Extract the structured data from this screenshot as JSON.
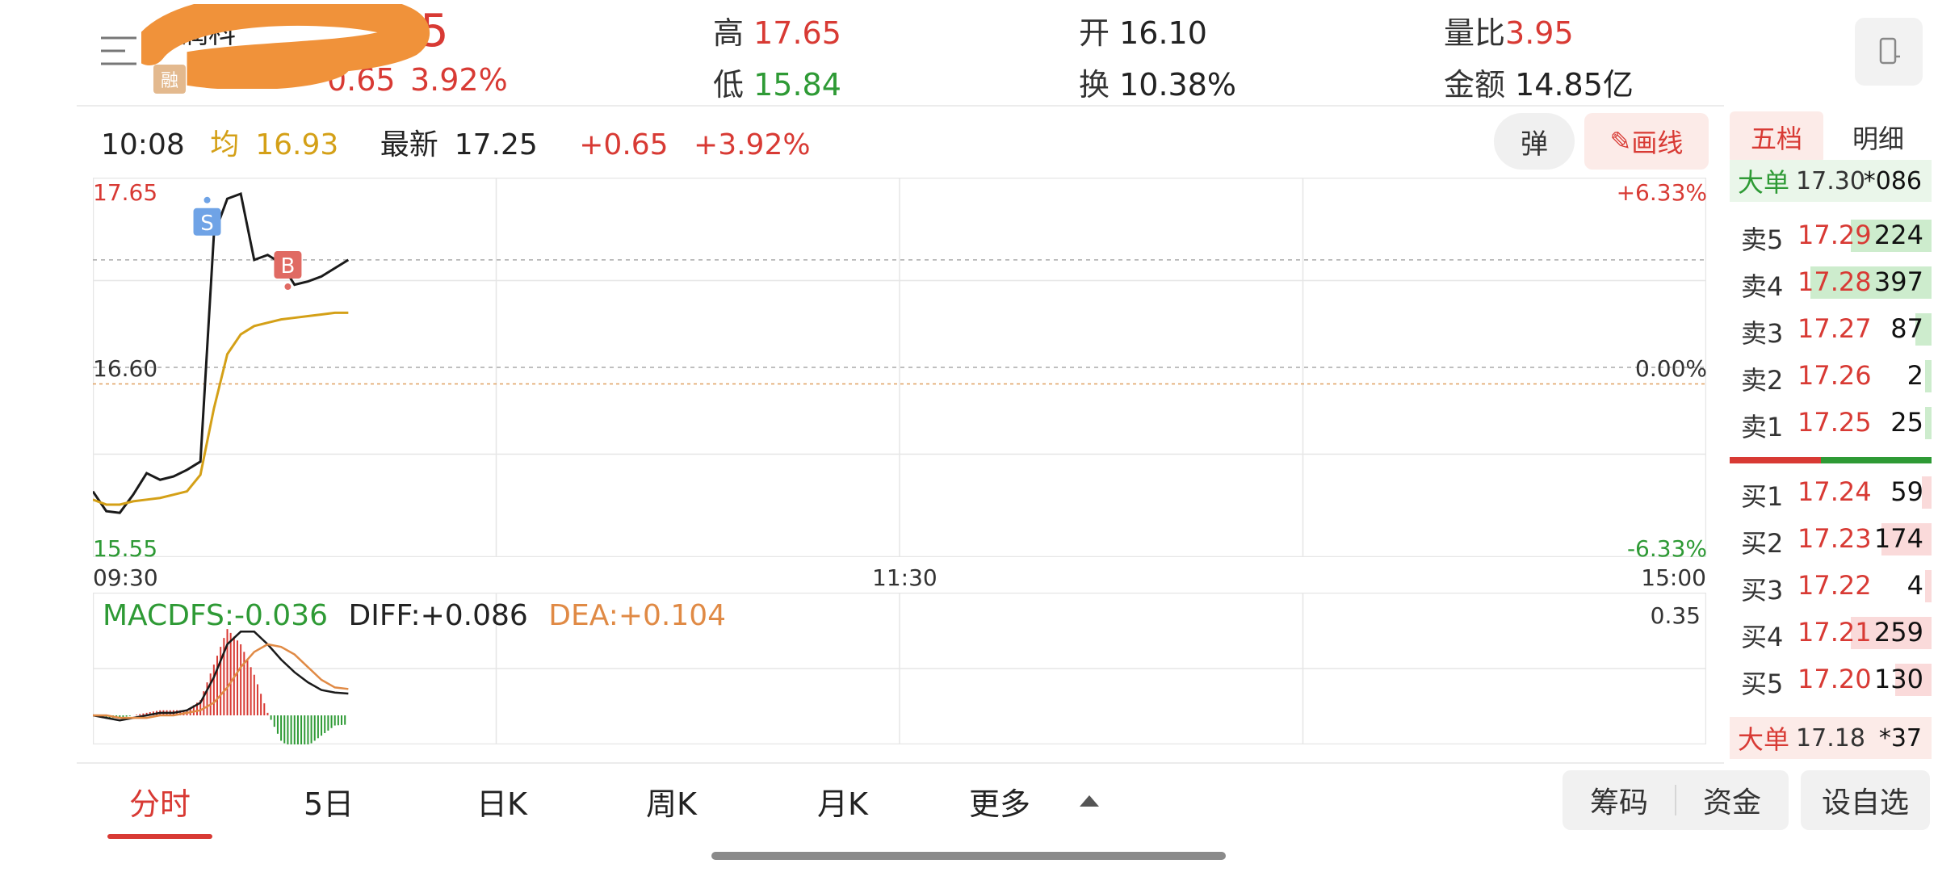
{
  "header": {
    "stock_name": "万润科",
    "price_fragment": "5",
    "rong_badge": "融",
    "change_amount": "0.65",
    "change_percent": "3.92%",
    "high": {
      "label": "高",
      "value": "17.65"
    },
    "low": {
      "label": "低",
      "value": "15.84"
    },
    "open": {
      "label": "开",
      "value": "16.10"
    },
    "turnover": {
      "label": "换",
      "value": "10.38%"
    },
    "volume_ratio": {
      "label": "量比",
      "value": "3.95"
    },
    "amount": {
      "label": "金额",
      "value": "14.85亿"
    }
  },
  "status": {
    "time": "10:08",
    "avg_label": "均",
    "avg_value": "16.93",
    "latest_label": "最新",
    "latest_value": "17.25",
    "change_amount": "+0.65",
    "change_percent": "+3.92%",
    "pop_button": "弹",
    "draw_button": "画线"
  },
  "chart_data": [
    {
      "type": "line",
      "title": "",
      "x_range": [
        "09:30",
        "15:00"
      ],
      "x_ticks": [
        "09:30",
        "11:30",
        "15:00"
      ],
      "y_left_ticks": [
        "17.65",
        "16.60",
        "15.55"
      ],
      "y_right_ticks": [
        "+6.33%",
        "0.00%",
        "-6.33%"
      ],
      "ylim": [
        15.55,
        17.65
      ],
      "reference_price": 16.6,
      "series": [
        {
          "name": "最新",
          "color": "#1a1a1a",
          "x": [
            0,
            2,
            4,
            6,
            8,
            10,
            12,
            14,
            16,
            18,
            20,
            22,
            24,
            26,
            28,
            30,
            32,
            34,
            36,
            38
          ],
          "values": [
            15.85,
            15.73,
            15.72,
            15.83,
            15.96,
            15.92,
            15.94,
            15.98,
            16.03,
            17.4,
            17.62,
            17.65,
            17.25,
            17.28,
            17.23,
            17.1,
            17.12,
            17.15,
            17.2,
            17.25
          ]
        },
        {
          "name": "均",
          "color": "#d4a017",
          "x": [
            0,
            2,
            4,
            6,
            8,
            10,
            12,
            14,
            16,
            18,
            20,
            22,
            24,
            26,
            28,
            30,
            32,
            34,
            36,
            38
          ],
          "values": [
            15.8,
            15.77,
            15.77,
            15.79,
            15.8,
            15.81,
            15.83,
            15.85,
            15.95,
            16.35,
            16.68,
            16.8,
            16.85,
            16.87,
            16.89,
            16.9,
            16.91,
            16.92,
            16.93,
            16.93
          ]
        }
      ],
      "annotations": [
        {
          "label": "S",
          "x": 17,
          "price": 17.48
        },
        {
          "label": "B",
          "x": 29,
          "price": 17.22
        }
      ]
    },
    {
      "type": "bar",
      "title": "MACD",
      "legend": [
        "MACDFS:-0.036",
        "DIFF:+0.086",
        "DEA:+0.104"
      ],
      "y_top_label": "0.35",
      "x": [
        0,
        2,
        4,
        6,
        8,
        10,
        12,
        14,
        16,
        18,
        20,
        22,
        24,
        26,
        28,
        30,
        32,
        34,
        36,
        38
      ],
      "diff": [
        0.0,
        -0.01,
        -0.02,
        -0.01,
        0.0,
        0.01,
        0.01,
        0.02,
        0.05,
        0.15,
        0.28,
        0.33,
        0.33,
        0.28,
        0.22,
        0.17,
        0.13,
        0.1,
        0.09,
        0.086
      ],
      "dea": [
        0.0,
        0.0,
        -0.01,
        -0.01,
        -0.01,
        0.0,
        0.0,
        0.01,
        0.02,
        0.05,
        0.11,
        0.19,
        0.25,
        0.28,
        0.27,
        0.24,
        0.19,
        0.14,
        0.11,
        0.104
      ],
      "macd": [
        0.0,
        -0.01,
        -0.01,
        0.0,
        0.01,
        0.02,
        0.02,
        0.02,
        0.06,
        0.2,
        0.34,
        0.28,
        0.16,
        0.01,
        -0.1,
        -0.14,
        -0.12,
        -0.08,
        -0.04,
        -0.036
      ]
    }
  ],
  "order_book": {
    "tabs": [
      "五档",
      "明细"
    ],
    "big_top": {
      "label": "大单",
      "price": "17.30",
      "vol": "*086"
    },
    "asks": [
      {
        "label": "卖5",
        "price": "17.29",
        "vol": "224",
        "bar": 0.4
      },
      {
        "label": "卖4",
        "price": "17.28",
        "vol": "397",
        "bar": 0.6
      },
      {
        "label": "卖3",
        "price": "17.27",
        "vol": "87",
        "bar": 0.08
      },
      {
        "label": "卖2",
        "price": "17.26",
        "vol": "2",
        "bar": 0.03
      },
      {
        "label": "卖1",
        "price": "17.25",
        "vol": "25",
        "bar": 0.03
      }
    ],
    "bids": [
      {
        "label": "买1",
        "price": "17.24",
        "vol": "59",
        "bar": 0.05
      },
      {
        "label": "买2",
        "price": "17.23",
        "vol": "174",
        "bar": 0.25
      },
      {
        "label": "买3",
        "price": "17.22",
        "vol": "4",
        "bar": 0.02
      },
      {
        "label": "买4",
        "price": "17.21",
        "vol": "259",
        "bar": 0.4
      },
      {
        "label": "买5",
        "price": "17.20",
        "vol": "130",
        "bar": 0.18
      }
    ],
    "buy_ratio": 0.45,
    "big_bottom": {
      "label": "大单",
      "price": "17.18",
      "vol": "*37"
    }
  },
  "bottom_tabs": {
    "items": [
      "分时",
      "5日",
      "日K",
      "周K",
      "月K",
      "更多"
    ],
    "active": "分时"
  },
  "bottom_buttons": {
    "chouma": "筹码",
    "zijin": "资金",
    "zixuan": "设自选"
  },
  "colors": {
    "up": "#d83a34",
    "down": "#2e9a35",
    "avg": "#d4a017",
    "dea": "#e08a45"
  }
}
